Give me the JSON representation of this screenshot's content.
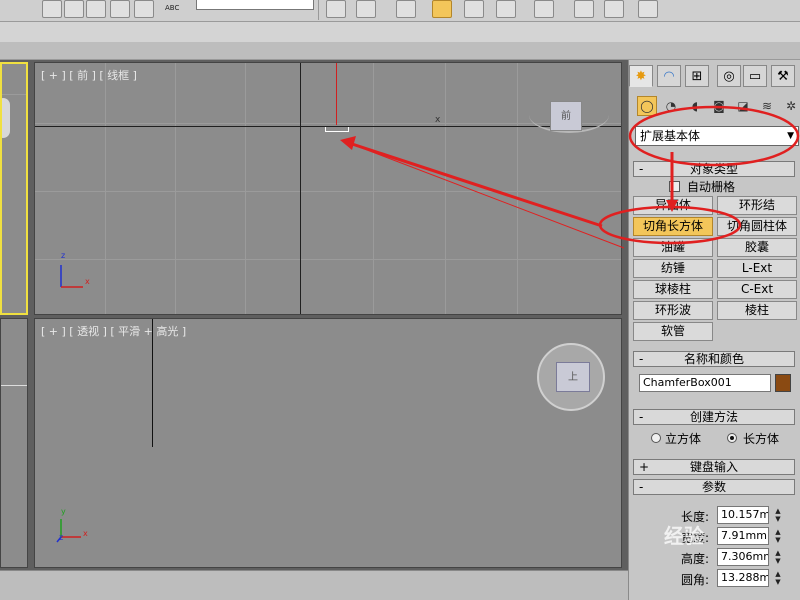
{
  "toolbar": {
    "abc_label": "ABC",
    "colors": {
      "active": "#f3c65a"
    },
    "icons": [
      "magnet-icon",
      "snap-icon",
      "percent-snap-icon",
      "spinner-snap-icon",
      "mirror-icon",
      "align-icon",
      "layer-icon",
      "curve-editor-icon",
      "schematic-icon",
      "material-editor-icon",
      "render-setup-icon",
      "render-frame-icon",
      "render-icon"
    ]
  },
  "viewports": {
    "front": {
      "label": "[ + ] [ 前 ] [ 线框 ]",
      "axis_x": "x",
      "axis_z": "z"
    },
    "perspective": {
      "label": "[ + ] [ 透视 ] [ 平滑 + 高光 ]",
      "axis_x": "x",
      "axis_y": "y",
      "axis_z": "z"
    },
    "viewcube_front": "前",
    "viewcube_perspective": "上"
  },
  "command_panel": {
    "tabs": [
      "create-icon",
      "modify-icon",
      "hierarchy-icon",
      "motion-icon",
      "display-icon",
      "utilities-icon"
    ],
    "subcategories": [
      "geometry-icon",
      "shapes-icon",
      "lights-icon",
      "cameras-icon",
      "helpers-icon",
      "spacewarps-icon",
      "systems-icon"
    ],
    "category_value": "扩展基本体",
    "object_type": {
      "header": "对象类型",
      "autogrid_label": "自动栅格",
      "buttons": [
        {
          "label": "异面体",
          "selected": false
        },
        {
          "label": "环形结",
          "selected": false
        },
        {
          "label": "切角长方体",
          "selected": true
        },
        {
          "label": "切角圆柱体",
          "selected": false
        },
        {
          "label": "油罐",
          "selected": false
        },
        {
          "label": "胶囊",
          "selected": false
        },
        {
          "label": "纺锤",
          "selected": false
        },
        {
          "label": "L-Ext",
          "selected": false
        },
        {
          "label": "球棱柱",
          "selected": false
        },
        {
          "label": "C-Ext",
          "selected": false
        },
        {
          "label": "环形波",
          "selected": false
        },
        {
          "label": "棱柱",
          "selected": false
        },
        {
          "label": "软管",
          "selected": false
        }
      ]
    },
    "name_color": {
      "header": "名称和颜色",
      "name_value": "ChamferBox001",
      "color": "#8a4a12"
    },
    "creation_method": {
      "header": "创建方法",
      "option_cube": "立方体",
      "option_box": "长方体",
      "selected": "长方体"
    },
    "keyboard_entry": {
      "header": "键盘输入",
      "sign": "+"
    },
    "parameters": {
      "header": "参数",
      "length_label": "长度:",
      "length_value": "10.157mm",
      "width_label": "宽度:",
      "width_value": "7.91mm",
      "height_label": "高度:",
      "height_value": "7.306mm",
      "fillet_label": "圆角:",
      "fillet_value": "13.288mm"
    }
  },
  "annotation_color": "#e02020",
  "watermark": "经验"
}
